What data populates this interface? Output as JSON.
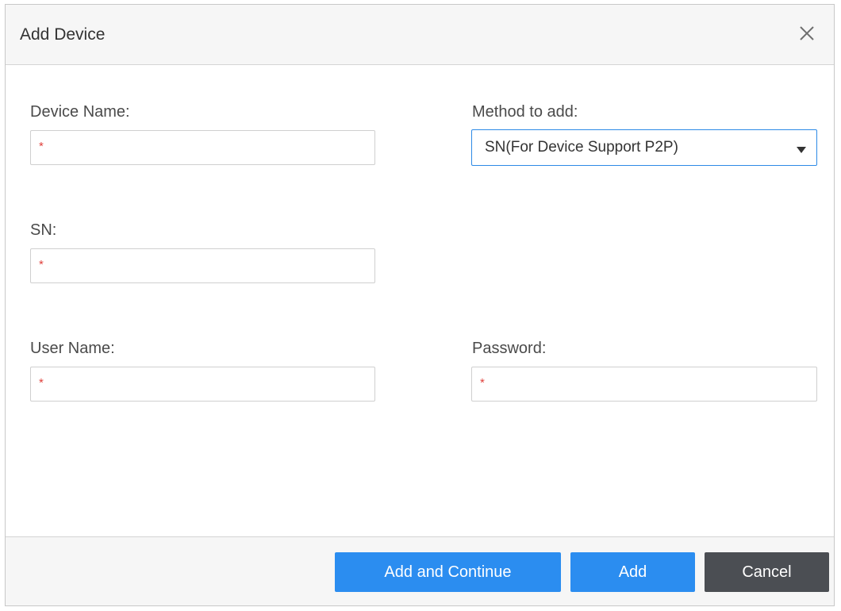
{
  "dialog": {
    "title": "Add Device"
  },
  "form": {
    "device_name": {
      "label": "Device Name:",
      "required_mark": "*",
      "value": ""
    },
    "method": {
      "label": "Method to add:",
      "selected": "SN(For Device Support P2P)"
    },
    "sn": {
      "label": "SN:",
      "required_mark": "*",
      "value": ""
    },
    "user_name": {
      "label": "User Name:",
      "required_mark": "*",
      "value": ""
    },
    "password": {
      "label": "Password:",
      "required_mark": "*",
      "value": ""
    }
  },
  "footer": {
    "add_continue_label": "Add and Continue",
    "add_label": "Add",
    "cancel_label": "Cancel"
  },
  "icons": {
    "close": "close-icon",
    "dropdown": "caret-down-icon"
  },
  "colors": {
    "primary_button": "#2b8df0",
    "cancel_button": "#4b4e53",
    "required_mark": "#e0413c",
    "select_border": "#2d8ae6"
  }
}
